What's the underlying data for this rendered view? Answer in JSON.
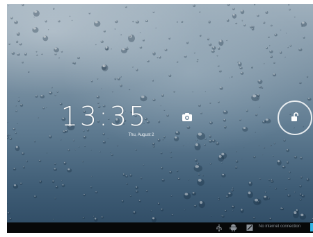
{
  "lockscreen": {
    "time": "13:35",
    "date": "Thu, August 2"
  },
  "icons": {
    "camera": "camera-icon",
    "unlock": "unlock-icon",
    "usb": "usb-icon",
    "android": "android-icon",
    "status": "notification-icon"
  },
  "status_bar": {
    "connection_text": "No internet connection"
  },
  "colors": {
    "accent": "#33b5e5",
    "navbar": "#070809",
    "wallpaper_top": "#9fb0bd",
    "wallpaper_bottom": "#2e4a63"
  }
}
